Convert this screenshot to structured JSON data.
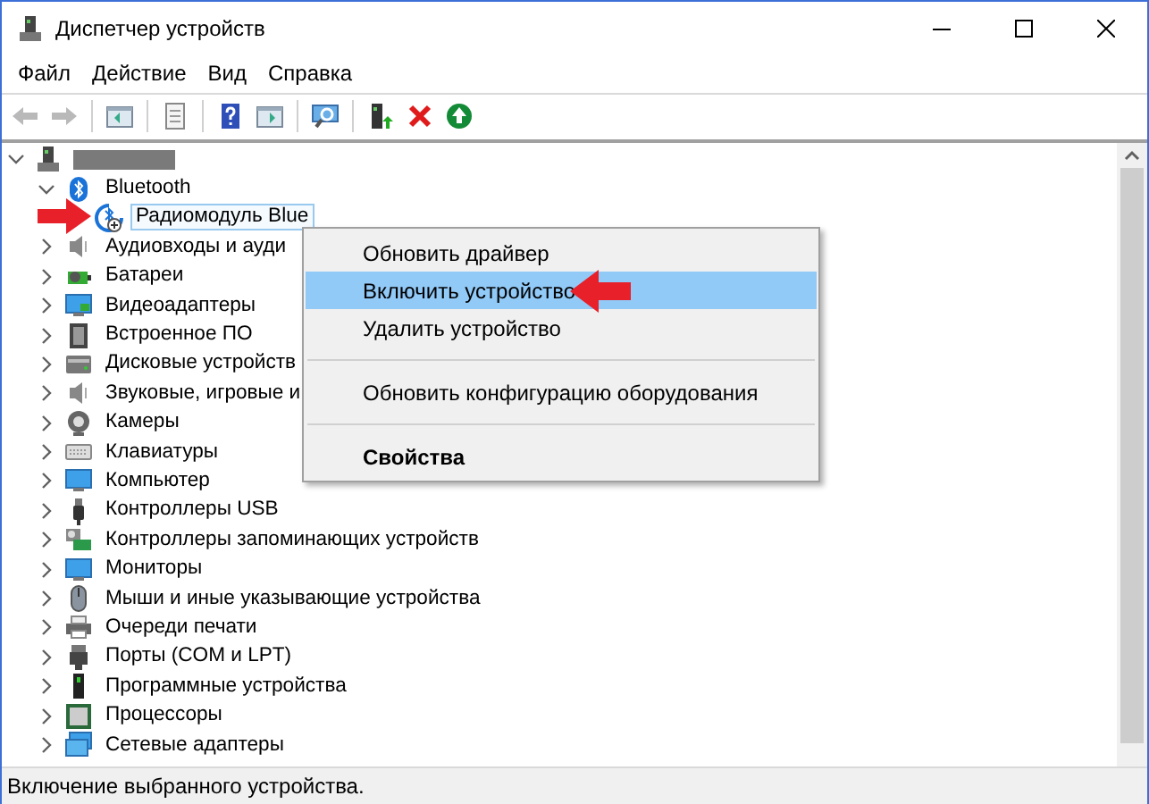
{
  "window": {
    "title": "Диспетчер устройств"
  },
  "menu_bar": [
    "Файл",
    "Действие",
    "Вид",
    "Справка"
  ],
  "toolbar": [
    {
      "disabled": true
    },
    {
      "disabled": true
    },
    {
      "disabled": false
    },
    {
      "disabled": false
    },
    {
      "disabled": false
    },
    {
      "disabled": false
    },
    {
      "disabled": false
    },
    {
      "disabled": false
    },
    {
      "disabled": false
    },
    {
      "disabled": false
    }
  ],
  "tree": [
    {
      "redacted": true,
      "expanded": true,
      "selected": false,
      "children": [
        {
          "label": "Bluetooth",
          "expanded": true,
          "selected": false,
          "children": [
            {
              "label": "Радиомодуль Blue",
              "selected": true
            }
          ]
        },
        {
          "label": "Аудиовходы и ауди",
          "expanded": false,
          "selected": false
        },
        {
          "label": "Батареи",
          "expanded": false,
          "selected": false
        },
        {
          "label": "Видеоадаптеры",
          "expanded": false,
          "selected": false
        },
        {
          "label": "Встроенное ПО",
          "expanded": false,
          "selected": false
        },
        {
          "label": "Дисковые устройств",
          "expanded": false,
          "selected": false
        },
        {
          "label": "Звуковые, игровые и",
          "expanded": false,
          "selected": false
        },
        {
          "label": "Камеры",
          "expanded": false,
          "selected": false
        },
        {
          "label": "Клавиатуры",
          "expanded": false,
          "selected": false
        },
        {
          "label": "Компьютер",
          "expanded": false,
          "selected": false
        },
        {
          "label": "Контроллеры USB",
          "expanded": false,
          "selected": false
        },
        {
          "label": "Контроллеры запоминающих устройств",
          "expanded": false,
          "selected": false
        },
        {
          "label": "Мониторы",
          "expanded": false,
          "selected": false
        },
        {
          "label": "Мыши и иные указывающие устройства",
          "expanded": false,
          "selected": false
        },
        {
          "label": "Очереди печати",
          "expanded": false,
          "selected": false
        },
        {
          "label": "Порты (COM и LPT)",
          "expanded": false,
          "selected": false
        },
        {
          "label": "Программные устройства",
          "expanded": false,
          "selected": false
        },
        {
          "label": "Процессоры",
          "expanded": false,
          "selected": false
        },
        {
          "label": "Сетевые адаптеры",
          "expanded": false,
          "selected": false
        }
      ]
    }
  ],
  "context_menu": [
    {
      "kind": "item",
      "label": "Обновить драйвер",
      "selected": false,
      "default": false
    },
    {
      "kind": "item",
      "label": "Включить устройство",
      "selected": true,
      "default": false
    },
    {
      "kind": "item",
      "label": "Удалить устройство",
      "selected": false,
      "default": false
    },
    {
      "kind": "separator"
    },
    {
      "kind": "item",
      "label": "Обновить конфигурацию оборудования",
      "selected": false,
      "default": false
    },
    {
      "kind": "separator"
    },
    {
      "kind": "item",
      "label": "Свойства",
      "selected": false,
      "default": true
    }
  ],
  "status_bar": "Включение выбранного устройства."
}
